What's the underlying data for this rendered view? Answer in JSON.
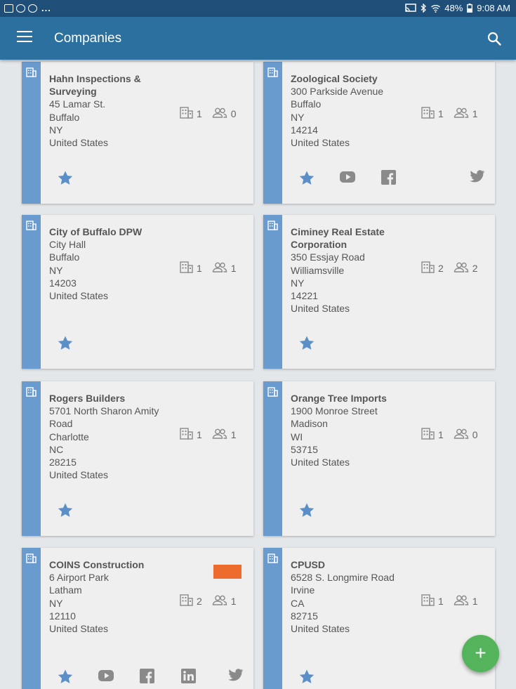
{
  "status_bar": {
    "battery": "48%",
    "time": "9:08 AM",
    "dots": "..."
  },
  "app_bar": {
    "title": "Companies"
  },
  "companies": [
    {
      "name_lines": [
        "Hahn Inspections &",
        "Surveying"
      ],
      "address_lines": [
        "45 Lamar St.",
        "Buffalo",
        "NY",
        "United States"
      ],
      "locations": "1",
      "contacts": "0",
      "socials": [
        "star-icon"
      ]
    },
    {
      "name_lines": [
        "Zoological Society"
      ],
      "address_lines": [
        "300 Parkside Avenue",
        "Buffalo",
        "NY",
        "14214",
        "United States"
      ],
      "locations": "1",
      "contacts": "1",
      "socials": [
        "star-icon",
        "youtube-icon",
        "facebook-icon",
        "twitter-icon"
      ]
    },
    {
      "name_lines": [
        "City of Buffalo DPW"
      ],
      "address_lines": [
        "City Hall",
        "Buffalo",
        "NY",
        "14203",
        "United States"
      ],
      "locations": "1",
      "contacts": "1",
      "socials": [
        "star-icon"
      ]
    },
    {
      "name_lines": [
        "Ciminey Real Estate",
        "Corporation"
      ],
      "address_lines": [
        "350 Essjay Road",
        "Williamsville",
        "NY",
        "14221",
        "United States"
      ],
      "locations": "2",
      "contacts": "2",
      "socials": [
        "star-icon"
      ]
    },
    {
      "name_lines": [
        "Rogers Builders"
      ],
      "address_lines": [
        "5701 North Sharon Amity",
        "Road",
        "Charlotte",
        "NC",
        "28215",
        "United States"
      ],
      "locations": "1",
      "contacts": "1",
      "socials": [
        "star-icon"
      ]
    },
    {
      "name_lines": [
        "Orange Tree Imports"
      ],
      "address_lines": [
        "1900 Monroe Street",
        "Madison",
        "WI",
        "53715",
        "United States"
      ],
      "locations": "1",
      "contacts": "0",
      "socials": [
        "star-icon"
      ]
    },
    {
      "name_lines": [
        "COINS Construction"
      ],
      "address_lines": [
        "6 Airport Park",
        "Latham",
        "NY",
        "12110",
        "United States"
      ],
      "locations": "2",
      "contacts": "1",
      "socials": [
        "star-icon",
        "youtube-icon",
        "facebook-icon",
        "linkedin-icon",
        "twitter-icon"
      ],
      "has_logo": true
    },
    {
      "name_lines": [
        "CPUSD"
      ],
      "address_lines": [
        "6528 S. Longmire Road",
        "Irvine",
        "CA",
        "82715",
        "United States"
      ],
      "locations": "1",
      "contacts": "1",
      "socials": [
        "star-icon"
      ]
    }
  ],
  "fab": {
    "label": "+"
  },
  "colors": {
    "app_bar": "#2c70a0",
    "status_bar": "#1f4f78",
    "stripe": "#6a9bcf",
    "star": "#5b8fc7",
    "fab": "#54b45b"
  }
}
